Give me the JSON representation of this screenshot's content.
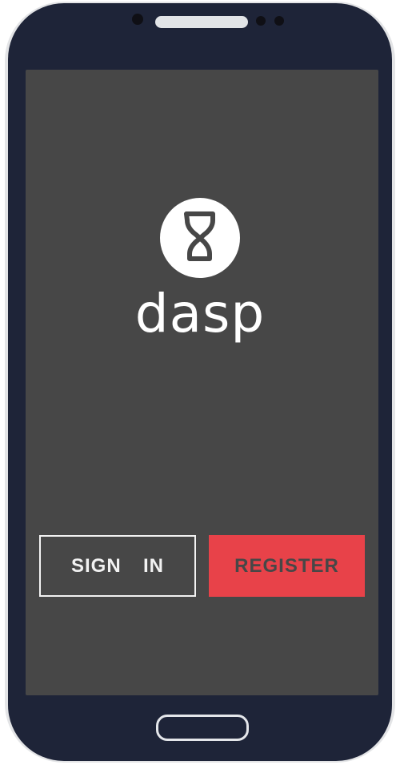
{
  "app": {
    "brand_name": "dasp",
    "logo_icon": "hourglass-icon"
  },
  "actions": {
    "sign_in_label": "SIGN  IN",
    "register_label": "REGISTER"
  },
  "colors": {
    "screen_background": "#474747",
    "register_accent": "#e84249",
    "phone_body": "#1e2438",
    "phone_bezel": "#e3e4e6"
  }
}
